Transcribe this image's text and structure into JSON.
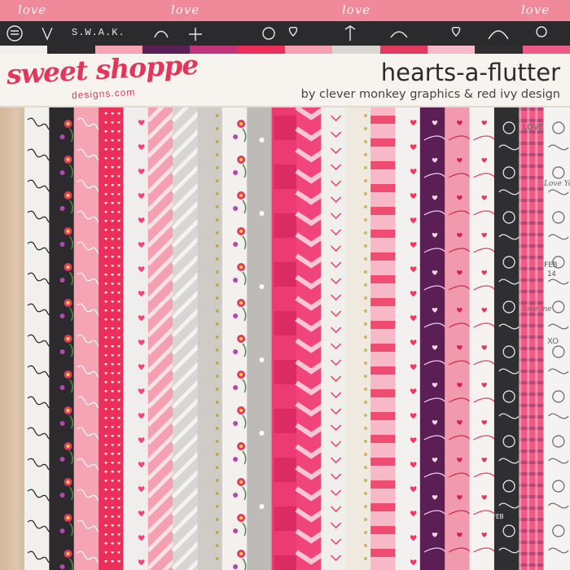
{
  "top_border": {
    "love_word": "love",
    "chalk_text": "S.W.A.K."
  },
  "header": {
    "brand": "sweet shoppe",
    "brand_sub": "designs.com",
    "kit_title": "hearts-a-flutter",
    "credits": "by clever monkey graphics & red ivy design"
  },
  "colors": {
    "pink": "#e2365c",
    "dark": "#2b2b2d",
    "purple": "#5a1f55",
    "light_pink": "#f6a8b8",
    "wood": "#d8c0a8"
  },
  "papers": [
    {
      "name": "white-script",
      "base": "#f2f0ec",
      "pattern": "script",
      "ink": "#2a2a2a"
    },
    {
      "name": "black-floral",
      "base": "#2c2a2c",
      "pattern": "floral",
      "ink": "#e23a5e"
    },
    {
      "name": "pink-script",
      "base": "#f6a3b4",
      "pattern": "script",
      "ink": "#ffffff"
    },
    {
      "name": "red-hearts",
      "base": "#ec2f5a",
      "pattern": "tinyhearts",
      "ink": "#ffffff"
    },
    {
      "name": "white-hearts",
      "base": "#efeeec",
      "pattern": "hearts",
      "ink": "#f0457a"
    },
    {
      "name": "pink-stripes",
      "base": "#f59fb3",
      "pattern": "diag",
      "ink": "#fbe0e6"
    },
    {
      "name": "grey-stripes",
      "base": "#d8d6d3",
      "pattern": "diag",
      "ink": "#f4f3f1"
    },
    {
      "name": "grey-gold-dots",
      "base": "#cfccc8",
      "pattern": "golddots",
      "ink": "#c9a44a"
    },
    {
      "name": "white-floral",
      "base": "#f3f0ee",
      "pattern": "floral",
      "ink": "#e23a5e"
    },
    {
      "name": "grey-plain",
      "base": "#bdbab7",
      "pattern": "dots",
      "ink": "#ffffff"
    },
    {
      "name": "pink-paint",
      "base": "#ec3a72",
      "pattern": "paint",
      "ink": "#c81e52"
    },
    {
      "name": "pink-chevron",
      "base": "#f0447a",
      "pattern": "chevron",
      "ink": "#f9c6d5"
    },
    {
      "name": "white-arrows",
      "base": "#f1efec",
      "pattern": "arrows",
      "ink": "#ec3a62"
    },
    {
      "name": "white-gold",
      "base": "#efe9df",
      "pattern": "golddots",
      "ink": "#d2b169"
    },
    {
      "name": "pink-bands",
      "base": "#f7b9c7",
      "pattern": "bands",
      "ink": "#ec3a62"
    },
    {
      "name": "white-hearts-2",
      "base": "#f3f1ef",
      "pattern": "hearts",
      "ink": "#ec3a62"
    },
    {
      "name": "purple-doodle",
      "base": "#5b1f56",
      "pattern": "doodle",
      "ink": "#f2d6e6"
    },
    {
      "name": "pink-doodle",
      "base": "#f199ad",
      "pattern": "doodle",
      "ink": "#d81f4c"
    },
    {
      "name": "white-doodle",
      "base": "#f5f2f0",
      "pattern": "doodle",
      "ink": "#e23a5e"
    },
    {
      "name": "black-chalk",
      "base": "#2f2e30",
      "pattern": "chalk",
      "ink": "#f2f2f2"
    },
    {
      "name": "pink-plaid",
      "base": "#ee5a86",
      "pattern": "plaid",
      "ink": "#7a2d5e"
    },
    {
      "name": "white-chalk",
      "base": "#f4f3f1",
      "pattern": "chalk",
      "ink": "#666666"
    }
  ],
  "paper_texts": {
    "chalk_feb": "FEB",
    "chalk_14": "14",
    "love_you": "Love You",
    "love_me": "love me",
    "xo": "XO",
    "love": "LOVE"
  }
}
